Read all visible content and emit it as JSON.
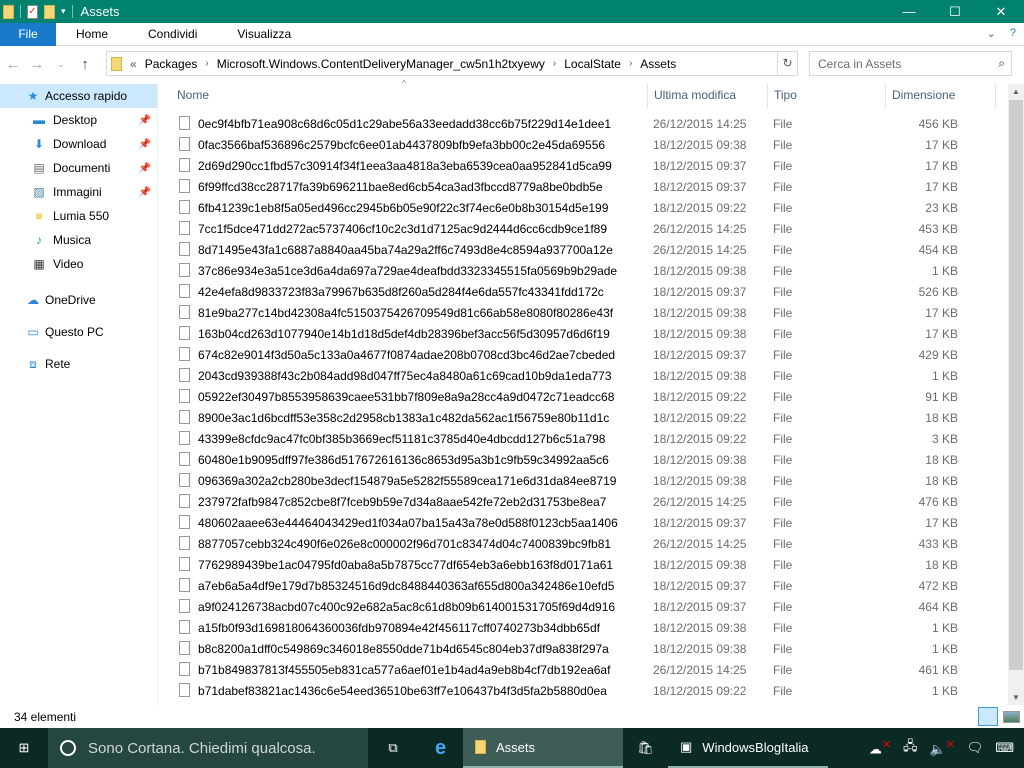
{
  "window": {
    "title": "Assets",
    "minimize": "—",
    "maximize": "☐",
    "close": "✕"
  },
  "ribbon": {
    "tabs": [
      "File",
      "Home",
      "Condividi",
      "Visualizza"
    ]
  },
  "address": {
    "overflow": "«",
    "crumbs": [
      "Packages",
      "Microsoft.Windows.ContentDeliveryManager_cw5n1h2txyewy",
      "LocalState",
      "Assets"
    ]
  },
  "search": {
    "placeholder": "Cerca in Assets"
  },
  "sidebar": {
    "items": [
      {
        "label": "Accesso rapido",
        "icon": "star-icon",
        "level": "top",
        "selected": true
      },
      {
        "label": "Desktop",
        "icon": "desktop-icon",
        "level": "sub",
        "pinned": true
      },
      {
        "label": "Download",
        "icon": "download-icon",
        "level": "sub",
        "pinned": true
      },
      {
        "label": "Documenti",
        "icon": "documents-icon",
        "level": "sub",
        "pinned": true
      },
      {
        "label": "Immagini",
        "icon": "pictures-icon",
        "level": "sub",
        "pinned": true
      },
      {
        "label": "Lumia 550",
        "icon": "folder-icon",
        "level": "sub"
      },
      {
        "label": "Musica",
        "icon": "music-icon",
        "level": "sub"
      },
      {
        "label": "Video",
        "icon": "video-icon",
        "level": "sub"
      },
      {
        "label": "OneDrive",
        "icon": "cloud-icon",
        "level": "top"
      },
      {
        "label": "Questo PC",
        "icon": "computer-icon",
        "level": "top"
      },
      {
        "label": "Rete",
        "icon": "network-icon",
        "level": "top"
      }
    ]
  },
  "columns": {
    "name": "Nome",
    "modified": "Ultima modifica",
    "type": "Tipo",
    "size": "Dimensione"
  },
  "files": [
    [
      "0ec9f4bfb71ea908c68d6c05d1c29abe56a33eedadd38cc6b75f229d14e1dee1",
      "26/12/2015 14:25",
      "File",
      "456 KB"
    ],
    [
      "0fac3566baf536896c2579bcfc6ee01ab4437809bfb9efa3bb00c2e45da69556",
      "18/12/2015 09:38",
      "File",
      "17 KB"
    ],
    [
      "2d69d290cc1fbd57c30914f34f1eea3aa4818a3eba6539cea0aa952841d5ca99",
      "18/12/2015 09:37",
      "File",
      "17 KB"
    ],
    [
      "6f99ffcd38cc28717fa39b696211bae8ed6cb54ca3ad3fbccd8779a8be0bdb5e",
      "18/12/2015 09:37",
      "File",
      "17 KB"
    ],
    [
      "6fb41239c1eb8f5a05ed496cc2945b6b05e90f22c3f74ec6e0b8b30154d5e199",
      "18/12/2015 09:22",
      "File",
      "23 KB"
    ],
    [
      "7cc1f5dce471dd272ac5737406cf10c2c3d1d7125ac9d2444d6cc6cdb9ce1f89",
      "26/12/2015 14:25",
      "File",
      "453 KB"
    ],
    [
      "8d71495e43fa1c6887a8840aa45ba74a29a2ff6c7493d8e4c8594a937700a12e",
      "26/12/2015 14:25",
      "File",
      "454 KB"
    ],
    [
      "37c86e934e3a51ce3d6a4da697a729ae4deafbdd3323345515fa0569b9b29ade",
      "18/12/2015 09:38",
      "File",
      "1 KB"
    ],
    [
      "42e4efa8d9833723f83a79967b635d8f260a5d284f4e6da557fc43341fdd172c",
      "18/12/2015 09:37",
      "File",
      "526 KB"
    ],
    [
      "81e9ba277c14bd42308a4fc5150375426709549d81c66ab58e8080f80286e43f",
      "18/12/2015 09:38",
      "File",
      "17 KB"
    ],
    [
      "163b04cd263d1077940e14b1d18d5def4db28396bef3acc56f5d30957d6d6f19",
      "18/12/2015 09:38",
      "File",
      "17 KB"
    ],
    [
      "674c82e9014f3d50a5c133a0a4677f0874adae208b0708cd3bc46d2ae7cbeded",
      "18/12/2015 09:37",
      "File",
      "429 KB"
    ],
    [
      "2043cd939388f43c2b084add98d047ff75ec4a8480a61c69cad10b9da1eda773",
      "18/12/2015 09:38",
      "File",
      "1 KB"
    ],
    [
      "05922ef30497b8553958639caee531bb7f809e8a9a28cc4a9d0472c71eadcc68",
      "18/12/2015 09:22",
      "File",
      "91 KB"
    ],
    [
      "8900e3ac1d6bcdff53e358c2d2958cb1383a1c482da562ac1f56759e80b11d1c",
      "18/12/2015 09:22",
      "File",
      "18 KB"
    ],
    [
      "43399e8cfdc9ac47fc0bf385b3669ecf51181c3785d40e4dbcdd127b6c51a798",
      "18/12/2015 09:22",
      "File",
      "3 KB"
    ],
    [
      "60480e1b9095dff97fe386d517672616136c8653d95a3b1c9fb59c34992aa5c6",
      "18/12/2015 09:38",
      "File",
      "18 KB"
    ],
    [
      "096369a302a2cb280be3decf154879a5e5282f55589cea171e6d31da84ee8719",
      "18/12/2015 09:38",
      "File",
      "18 KB"
    ],
    [
      "237972fafb9847c852cbe8f7fceb9b59e7d34a8aae542fe72eb2d31753be8ea7",
      "26/12/2015 14:25",
      "File",
      "476 KB"
    ],
    [
      "480602aaee63e44464043429ed1f034a07ba15a43a78e0d588f0123cb5aa1406",
      "18/12/2015 09:37",
      "File",
      "17 KB"
    ],
    [
      "8877057cebb324c490f6e026e8c000002f96d701c83474d04c7400839bc9fb81",
      "26/12/2015 14:25",
      "File",
      "433 KB"
    ],
    [
      "7762989439be1ac04795fd0aba8a5b7875cc77df654eb3a6ebb163f8d0171a61",
      "18/12/2015 09:38",
      "File",
      "18 KB"
    ],
    [
      "a7eb6a5a4df9e179d7b85324516d9dc8488440363af655d800a342486e10efd5",
      "18/12/2015 09:37",
      "File",
      "472 KB"
    ],
    [
      "a9f024126738acbd07c400c92e682a5ac8c61d8b09b614001531705f69d4d916",
      "18/12/2015 09:37",
      "File",
      "464 KB"
    ],
    [
      "a15fb0f93d169818064360036fdb970894e42f456117cff0740273b34dbb65df",
      "18/12/2015 09:38",
      "File",
      "1 KB"
    ],
    [
      "b8c8200a1dff0c549869c346018e8550dde71b4d6545c804eb37df9a838f297a",
      "18/12/2015 09:38",
      "File",
      "1 KB"
    ],
    [
      "b71b849837813f455505eb831ca577a6aef01e1b4ad4a9eb8b4cf7db192ea6af",
      "26/12/2015 14:25",
      "File",
      "461 KB"
    ],
    [
      "b71dabef83821ac1436c6e54eed36510be63ff7e106437b4f3d5fa2b5880d0ea",
      "18/12/2015 09:22",
      "File",
      "1 KB"
    ]
  ],
  "status": {
    "count": "34 elementi"
  },
  "taskbar": {
    "cortana": "Sono Cortana. Chiedimi qualcosa.",
    "apps": [
      {
        "label": "Assets",
        "icon": "folder-icon",
        "active": true
      },
      {
        "label": "WindowsBlogItalia",
        "icon": "app-window-icon",
        "active": false
      }
    ]
  },
  "colors": {
    "titlebar": "#00826e",
    "file_tab": "#1979ca",
    "selection": "#cce8ff",
    "taskbar": "#0c2a24"
  }
}
